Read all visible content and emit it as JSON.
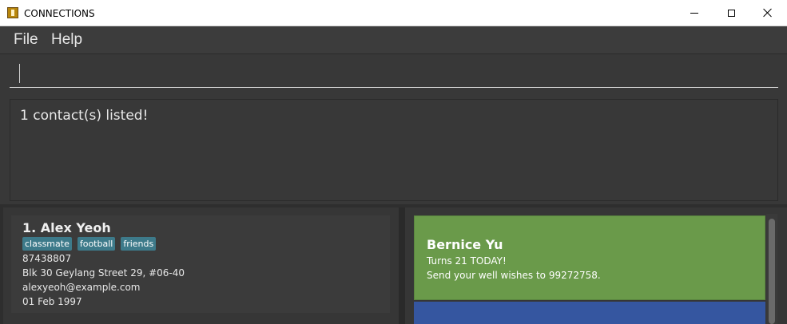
{
  "window": {
    "title": "CONNECTIONS"
  },
  "menu": {
    "file": "File",
    "help": "Help"
  },
  "command": {
    "value": ""
  },
  "result": {
    "message": "1 contact(s) listed!"
  },
  "person_list": [
    {
      "index_name": "1.  Alex Yeoh",
      "tags": [
        "classmate",
        "football",
        "friends"
      ],
      "phone": "87438807",
      "address": "Blk 30 Geylang Street 29, #06-40",
      "email": "alexyeoh@example.com",
      "birthday": "01 Feb 1997"
    }
  ],
  "birthday_reminders": [
    {
      "name": "Bernice Yu",
      "line1": "Turns 21 TODAY!",
      "line2": "Send your well wishes to 99272758.",
      "color": "#6a9a4a"
    }
  ],
  "colors": {
    "background": "#383838",
    "tag": "#3d7a8a",
    "birthday_card": "#6a9a4a",
    "next_card": "#3556a0"
  }
}
